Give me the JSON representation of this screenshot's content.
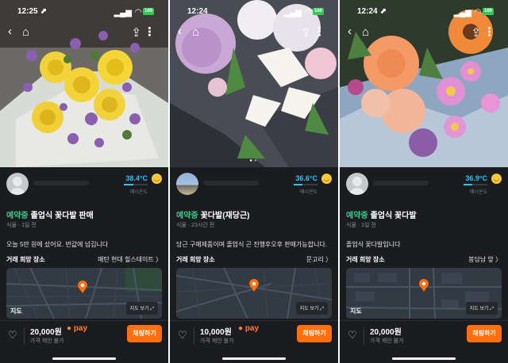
{
  "panels": [
    {
      "status": {
        "time": "12:25 ⬈",
        "battery": "100"
      },
      "temperature": "38.4°C",
      "temp_fill_pct": 38.4,
      "manner_label": "매너온도",
      "title_status": "예약중",
      "title": "졸업식 꽃다발 판매",
      "category": "식물 · 1일 전",
      "description": "오늘 5만 원에 샀어요. 반값에 넘깁니다",
      "place_label": "거래 희망 장소",
      "place_value": "매탄 현대 힐스테이트 〉",
      "map_logo": "지도",
      "map_button": "지도 보기 ⤢",
      "price": "20,000원",
      "pay": "pay",
      "negotiation": "가격 제안 불가",
      "chat_button": "채팅하기",
      "icons": {
        "back": "back-icon",
        "home": "home-icon",
        "share": "share-icon",
        "heart": "heart-icon"
      }
    },
    {
      "status": {
        "time": "12:24",
        "battery": "100"
      },
      "temperature": "36.6°C",
      "temp_fill_pct": 36.6,
      "manner_label": "매너온도",
      "title_status": "예약중",
      "title": "꽃다발(재당근)",
      "category": "식물 · 23시간 전",
      "description": "당근 구매제품이며 졸업식 곤 진행후오후 판매가능합니다.",
      "place_label": "거래 희망 장소",
      "place_value": "문고리 〉",
      "map_logo": "지도",
      "map_button": "지도 보기 ⤢",
      "price": "10,000원",
      "pay": "pay",
      "negotiation": "가격 제안 불가",
      "chat_button": "채팅하기"
    },
    {
      "status": {
        "time": "12:24 ⬈",
        "battery": "100"
      },
      "temperature": "36.9°C",
      "temp_fill_pct": 36.9,
      "manner_label": "매너온도",
      "title_status": "예약중",
      "title": "졸업식 꽃다발",
      "category": "식물 · 1일 전",
      "description": "졸업식 꽃다발입니다",
      "place_label": "거래 희망 장소",
      "place_value": "봉담남 앞 〉",
      "map_logo": "지도",
      "map_button": "지도 보기 ⤢",
      "price": "20,000원",
      "pay": "",
      "negotiation": "가격 제안 불가",
      "chat_button": "채팅하기"
    }
  ],
  "colors": {
    "accent": "#ff6f0f",
    "reserved": "#3ec98a",
    "temperature": "#34c0f0",
    "background": "#1b1c1f"
  }
}
